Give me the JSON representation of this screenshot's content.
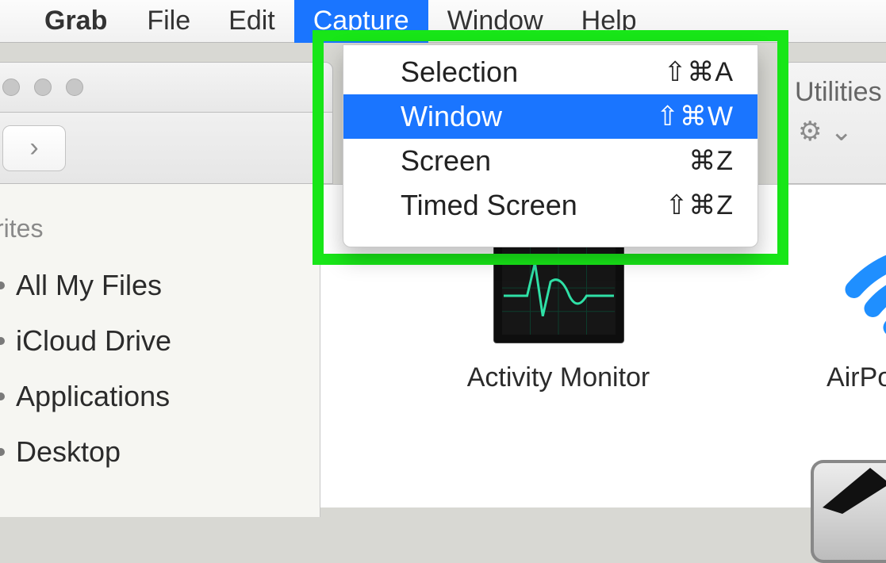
{
  "menubar": {
    "app": "Grab",
    "items": [
      "File",
      "Edit",
      "Capture",
      "Window",
      "Help"
    ],
    "active_index": 2
  },
  "dropdown": {
    "items": [
      {
        "label": "Selection",
        "shortcut": "⇧⌘A",
        "selected": false
      },
      {
        "label": "Window",
        "shortcut": "⇧⌘W",
        "selected": true
      },
      {
        "label": "Screen",
        "shortcut": "⌘Z",
        "selected": false
      },
      {
        "label": "Timed Screen",
        "shortcut": "⇧⌘Z",
        "selected": false
      }
    ]
  },
  "sidebar": {
    "heading_partial": "rites",
    "items": [
      {
        "label": "All My Files"
      },
      {
        "label": "iCloud Drive"
      },
      {
        "label": "Applications"
      },
      {
        "label": "Desktop"
      }
    ]
  },
  "right_panel": {
    "title_partial": "Utilities"
  },
  "content": {
    "apps": [
      {
        "name": "Activity Monitor"
      },
      {
        "name_partial": "AirPort"
      }
    ]
  },
  "icons": {
    "chevron_right": "›",
    "gear": "⚙",
    "chevron_down_small": "⌄"
  }
}
